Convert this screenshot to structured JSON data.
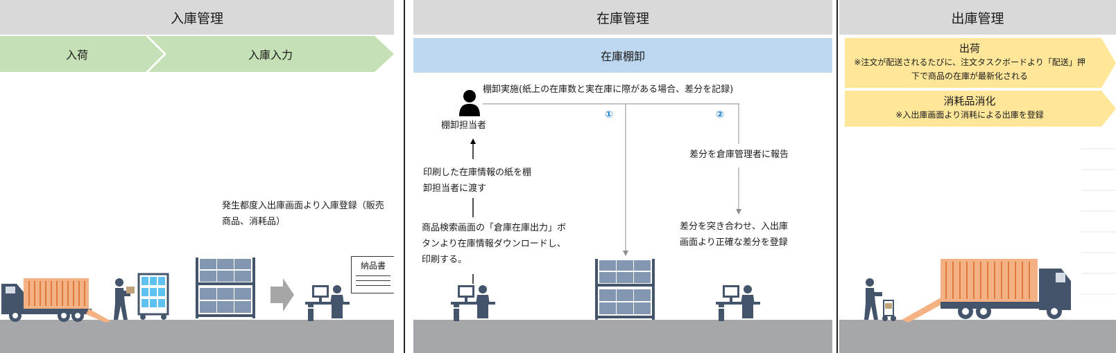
{
  "inbound": {
    "header": "入庫管理",
    "step1": "入荷",
    "step2": "入庫入力",
    "note": "発生都度入出庫画面より入庫登録（販売商品、消耗品）",
    "document_label": "納品書"
  },
  "inventory": {
    "header": "在庫管理",
    "bar": "在庫棚卸",
    "person_label": "棚卸担当者",
    "action": "棚卸実施(紙上の在庫数と実在庫に際がある場合、差分を記録)",
    "marker1": "①",
    "marker2": "②",
    "hand_over": "印刷した在庫情報の紙を棚卸担当者に渡す",
    "print_step": "商品検索画面の「倉庫在庫出力」ボタンより在庫情報ダウンロードし、印刷する。",
    "report": "差分を倉庫管理者に報告",
    "register": "差分を突き合わせ、入出庫画面より正確な差分を登録"
  },
  "outbound": {
    "header": "出庫管理",
    "shipping_title": "出荷",
    "shipping_note": "※注文が配送されるたびに、注文タスクボードより「配送」押下で商品の在庫が最新化される",
    "consumable_title": "消耗品消化",
    "consumable_note": "※入出庫画面より消耗による出庫を登録"
  },
  "colors": {
    "header_gray": "#d9d9d9",
    "green_arrow": "#c5e0b4",
    "blue_bar": "#bdd7ee",
    "yellow_note": "#ffe699",
    "ground": "#a6a7aa",
    "illustration": "#44546a",
    "truck_cargo": "#f4b183",
    "marker_blue": "#1f7fd1"
  },
  "icons": [
    "truck-icon",
    "worker-icon",
    "cart-icon",
    "shelf-icon",
    "arrow-right-icon",
    "computer-desk-icon",
    "document-icon",
    "person-icon"
  ]
}
